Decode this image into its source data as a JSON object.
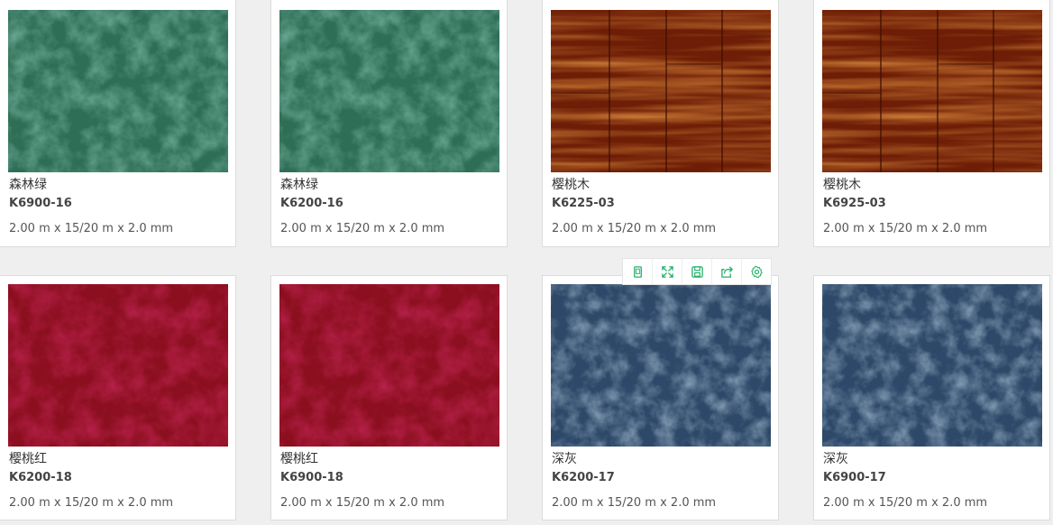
{
  "colors": {
    "forest_green": "#2e6e55",
    "cherry_wood": "#7a2208",
    "cherry_red": "#8e1020",
    "dark_grey": "#2e4a6a",
    "toolbar_accent": "#25b06a"
  },
  "card_toolbar": {
    "icons": [
      "copy-icon",
      "expand-icon",
      "save-icon",
      "share-icon",
      "settings-icon"
    ]
  },
  "products": [
    {
      "name": "森林绿",
      "code": "K6900-16",
      "spec": "2.00 m x 15/20 m x 2.0 mm",
      "texture": "forest_green"
    },
    {
      "name": "森林绿",
      "code": "K6200-16",
      "spec": "2.00 m x 15/20 m x 2.0 mm",
      "texture": "forest_green"
    },
    {
      "name": "樱桃木",
      "code": "K6225-03",
      "spec": "2.00 m x 15/20 m x 2.0 mm",
      "texture": "cherry_wood"
    },
    {
      "name": "樱桃木",
      "code": "K6925-03",
      "spec": "2.00 m x 15/20 m x 2.0 mm",
      "texture": "cherry_wood"
    },
    {
      "name": "樱桃红",
      "code": "K6200-18",
      "spec": "2.00 m x 15/20 m x 2.0 mm",
      "texture": "cherry_red"
    },
    {
      "name": "樱桃红",
      "code": "K6900-18",
      "spec": "2.00 m x 15/20 m x 2.0 mm",
      "texture": "cherry_red"
    },
    {
      "name": "深灰",
      "code": "K6200-17",
      "spec": "2.00 m x 15/20 m x 2.0 mm",
      "texture": "dark_grey"
    },
    {
      "name": "深灰",
      "code": "K6900-17",
      "spec": "2.00 m x 15/20 m x 2.0 mm",
      "texture": "dark_grey"
    }
  ]
}
